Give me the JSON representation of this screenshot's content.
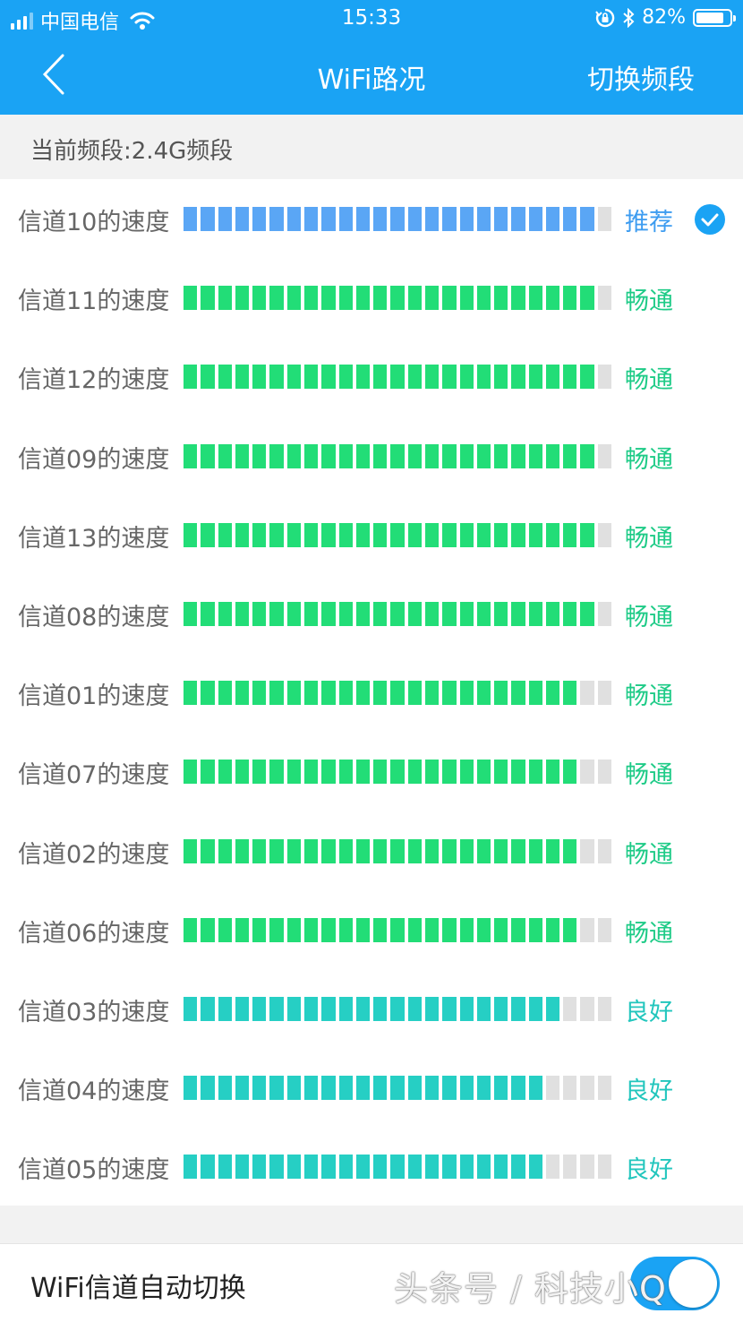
{
  "status_bar": {
    "carrier": "中国电信",
    "time": "15:33",
    "battery_text": "82%",
    "battery_level": 0.82,
    "signal_bars": 3
  },
  "nav": {
    "title": "WiFi路况",
    "right_action": "切换频段"
  },
  "band": {
    "label": "当前频段:2.4G频段"
  },
  "channels": [
    {
      "label": "信道10的速度",
      "filled": 24,
      "total": 25,
      "status": "推荐",
      "recommended": true
    },
    {
      "label": "信道11的速度",
      "filled": 24,
      "total": 25,
      "status": "畅通"
    },
    {
      "label": "信道12的速度",
      "filled": 24,
      "total": 25,
      "status": "畅通"
    },
    {
      "label": "信道09的速度",
      "filled": 24,
      "total": 25,
      "status": "畅通"
    },
    {
      "label": "信道13的速度",
      "filled": 24,
      "total": 25,
      "status": "畅通"
    },
    {
      "label": "信道08的速度",
      "filled": 24,
      "total": 25,
      "status": "畅通"
    },
    {
      "label": "信道01的速度",
      "filled": 23,
      "total": 25,
      "status": "畅通"
    },
    {
      "label": "信道07的速度",
      "filled": 23,
      "total": 25,
      "status": "畅通"
    },
    {
      "label": "信道02的速度",
      "filled": 23,
      "total": 25,
      "status": "畅通"
    },
    {
      "label": "信道06的速度",
      "filled": 23,
      "total": 25,
      "status": "畅通"
    },
    {
      "label": "信道03的速度",
      "filled": 22,
      "total": 25,
      "status": "良好"
    },
    {
      "label": "信道04的速度",
      "filled": 21,
      "total": 25,
      "status": "良好"
    },
    {
      "label": "信道05的速度",
      "filled": 21,
      "total": 25,
      "status": "良好"
    }
  ],
  "colors": {
    "header": "#1aa3f4",
    "recommended_bar": "#5aa6f5",
    "recommended_text": "#3d9cf0",
    "smooth_bar": "#22dd77",
    "smooth_text": "#1ecb87",
    "good_bar": "#26cfc4",
    "good_text": "#22c6bd",
    "empty_segment": "#e0e0e0"
  },
  "auto_switch": {
    "label": "WiFi信道自动切换",
    "enabled": true
  },
  "watermark": "头条号 / 科技小Q"
}
